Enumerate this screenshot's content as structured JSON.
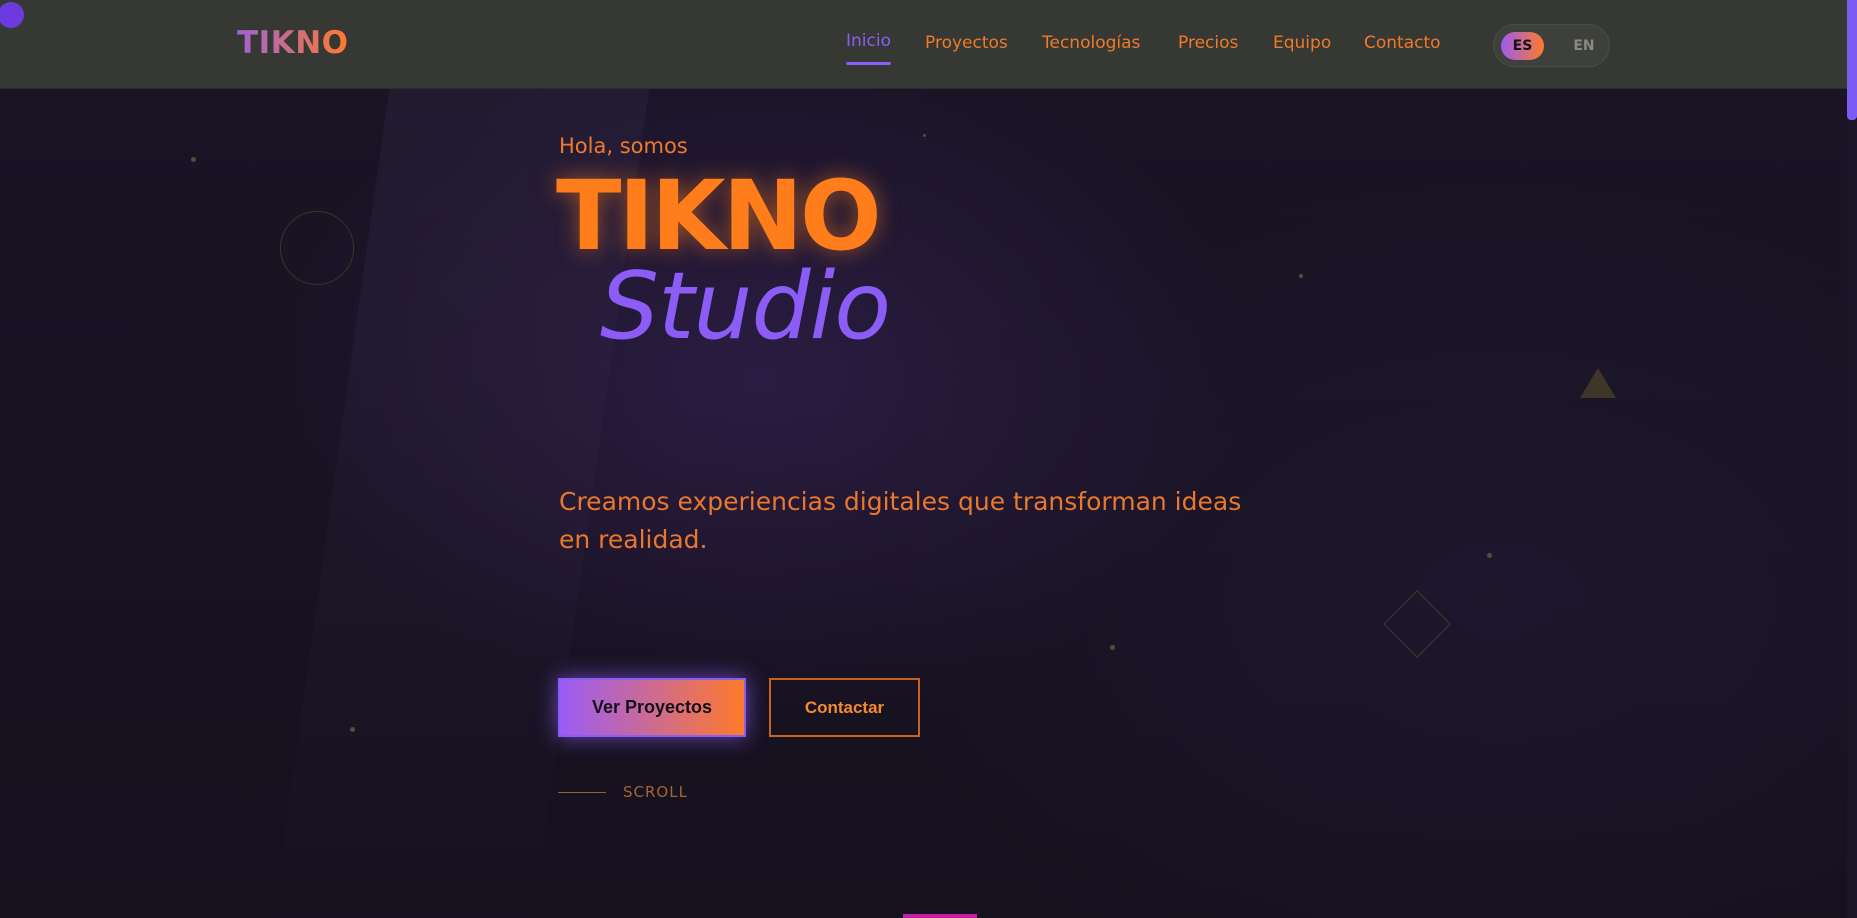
{
  "brand": {
    "logo": "TIKNO"
  },
  "nav": {
    "items": [
      {
        "label": "Inicio",
        "active": true
      },
      {
        "label": "Proyectos",
        "active": false
      },
      {
        "label": "Tecnologías",
        "active": false
      },
      {
        "label": "Precios",
        "active": false
      },
      {
        "label": "Equipo",
        "active": false
      },
      {
        "label": "Contacto",
        "active": false
      }
    ]
  },
  "language": {
    "options": [
      "ES",
      "EN"
    ],
    "selected": "ES"
  },
  "hero": {
    "greeting": "Hola, somos",
    "title": "TIKNO",
    "subtitle": "Studio",
    "tagline": "Creamos experiencias digitales que transforman ideas en realidad.",
    "primary_button": "Ver Proyectos",
    "secondary_button": "Contactar",
    "scroll_label": "SCROLL"
  },
  "colors": {
    "accent_orange": "#ff7d1a",
    "accent_purple": "#8b5cf6",
    "navbar_bg": "#363933",
    "page_bg": "#171222"
  }
}
